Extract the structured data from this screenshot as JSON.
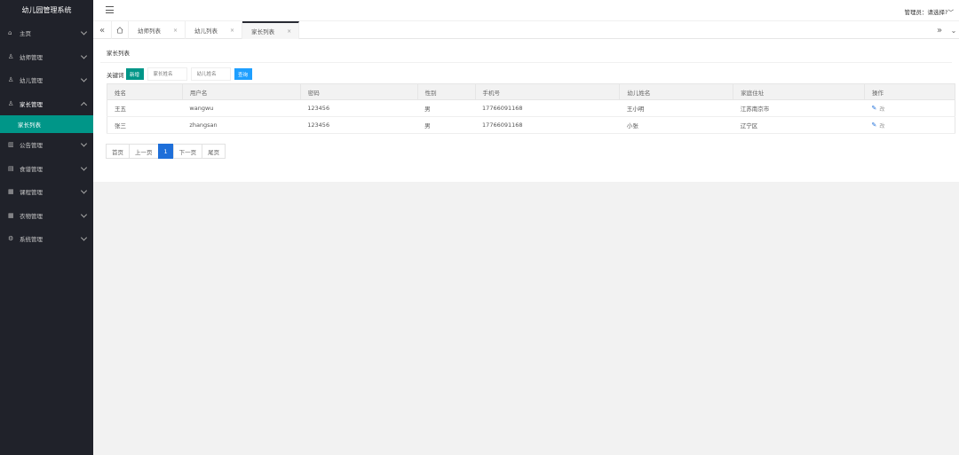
{
  "app": {
    "title": "幼儿园管理系统"
  },
  "sidebar": {
    "items": [
      {
        "label": "主页",
        "icon": "home-icon",
        "glyph": "⌂"
      },
      {
        "label": "幼师管理",
        "icon": "user-icon",
        "glyph": "♙"
      },
      {
        "label": "幼儿管理",
        "icon": "user-icon",
        "glyph": "♙"
      },
      {
        "label": "家长管理",
        "icon": "users-icon",
        "glyph": "♙"
      },
      {
        "label": "公告管理",
        "icon": "chart-icon",
        "glyph": "▥"
      },
      {
        "label": "食谱管理",
        "icon": "calendar-icon",
        "glyph": "▤"
      },
      {
        "label": "课程管理",
        "icon": "list-icon",
        "glyph": "▦"
      },
      {
        "label": "衣物管理",
        "icon": "grid-icon",
        "glyph": "▦"
      },
      {
        "label": "系统管理",
        "icon": "gear-icon",
        "glyph": "⚙"
      }
    ],
    "sub_item": "家长列表"
  },
  "header": {
    "admin_label": "管理员：请选择?",
    "admin_arrow": "﹀"
  },
  "tabs": [
    {
      "label": "幼师列表",
      "close": "×"
    },
    {
      "label": "幼儿列表",
      "close": "×"
    },
    {
      "label": "家长列表",
      "close": "×"
    }
  ],
  "tabnav": {
    "left": "«",
    "right": "»",
    "more": "⌄"
  },
  "main": {
    "title": "家长列表",
    "search": {
      "keyword_label": "关键词",
      "add_label": "新增",
      "parent_placeholder": "家长姓名",
      "child_placeholder": "幼儿姓名",
      "search_label": "查询"
    },
    "columns": [
      "姓名",
      "用户名",
      "密码",
      "性别",
      "手机号",
      "幼儿姓名",
      "家庭住址",
      "操作"
    ],
    "rows": [
      [
        "王五",
        "wangwu",
        "123456",
        "男",
        "17766091168",
        "王小明",
        "江苏南京市",
        "改"
      ],
      [
        "张三",
        "zhangsan",
        "123456",
        "男",
        "17766091168",
        "小张",
        "辽宁区",
        "改"
      ]
    ],
    "pager": [
      "首页",
      "上一页",
      "1",
      "下一页",
      "尾页"
    ]
  },
  "colors": {
    "sidebar_bg": "#20222a",
    "accent": "#009688",
    "blue": "#1e9fff",
    "page_active": "#1e6fd9"
  }
}
